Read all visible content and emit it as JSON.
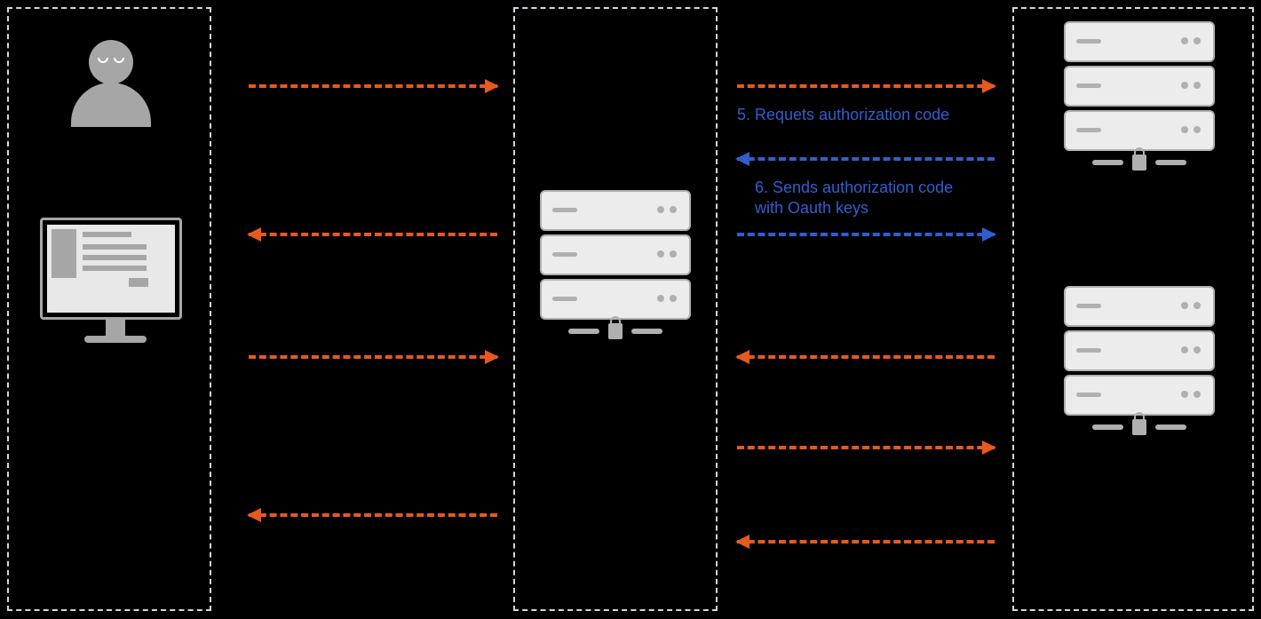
{
  "labels": {
    "step5": "5. Requets authorization code",
    "step6": "6. Sends authorization code with Oauth keys"
  }
}
